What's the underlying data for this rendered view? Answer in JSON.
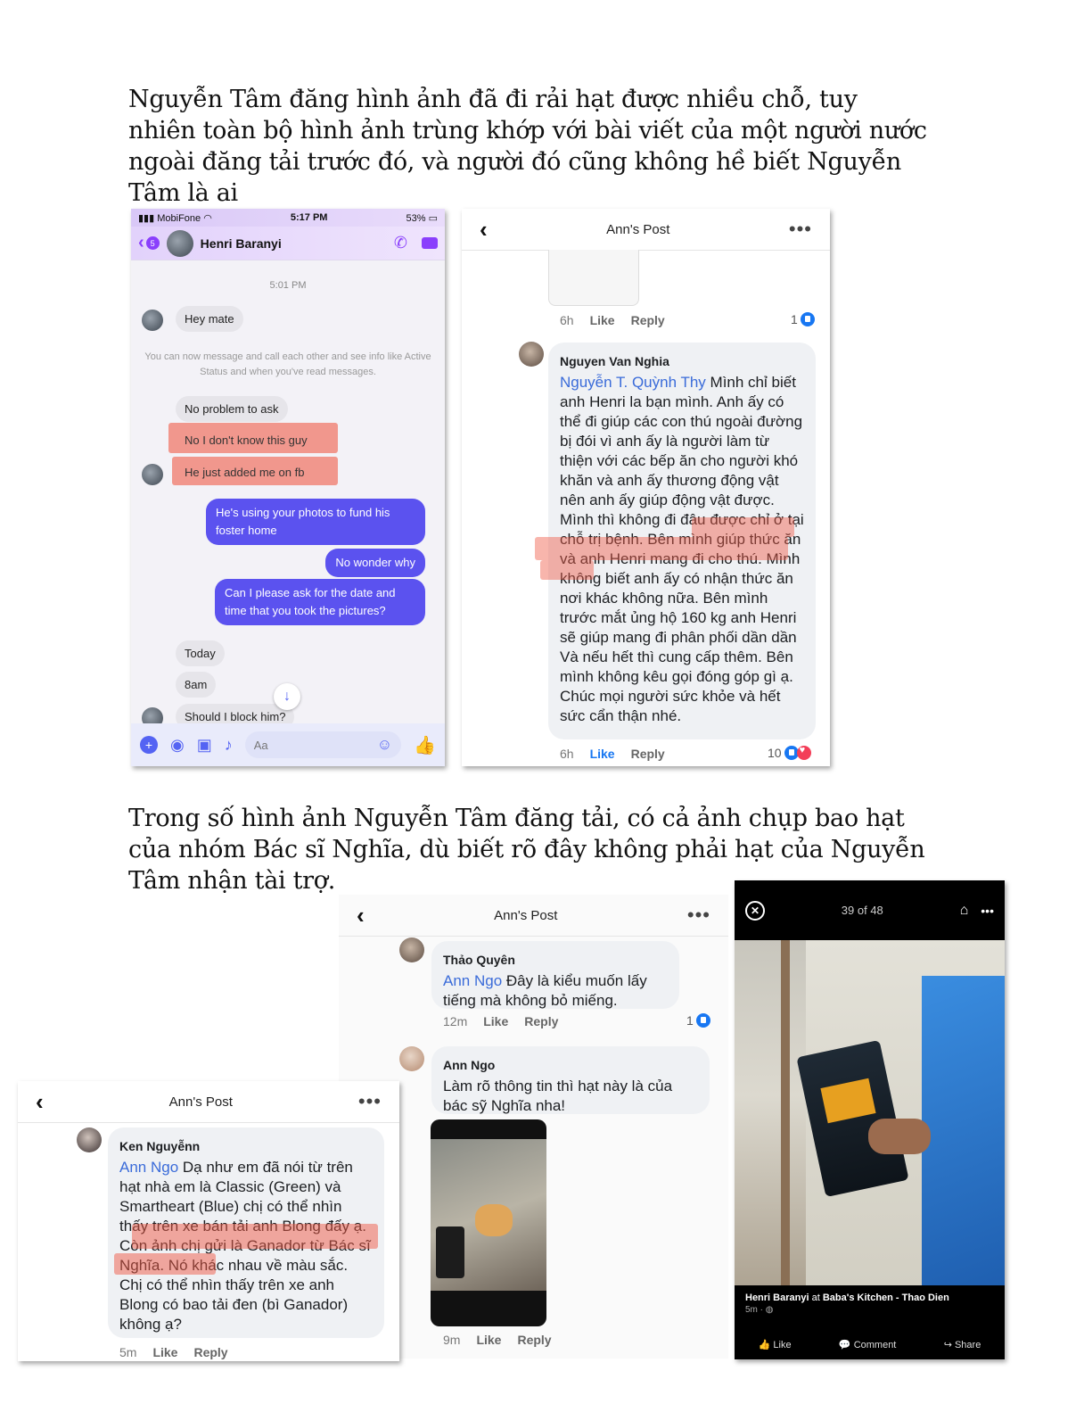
{
  "heading1": "Nguyễn Tâm đăng hình ảnh đã đi rải hạt được nhiều chỗ, tuy nhiên toàn bộ hình ảnh trùng khớp với bài viết của một người nước ngoài đăng tải trước đó, và người đó cũng không hề biết Nguyễn Tâm là ai",
  "heading2": "Trong số hình ảnh Nguyễn Tâm đăng tải, có cả ảnh chụp bao hạt của nhóm Bác sĩ Nghĩa, dù biết rõ đây không phải hạt của Nguyễn Tâm nhận tài trợ.",
  "messenger": {
    "carrier": "MobiFone",
    "time": "5:17 PM",
    "battery": "53%",
    "back_count": "5",
    "contact": "Henri Baranyi",
    "timestamp": "5:01 PM",
    "msg_hey": "Hey mate",
    "info": "You can now message and call each other and see info like Active Status and when you've read messages.",
    "msg_no_problem": "No problem to ask",
    "msg_dont_know": "No I don't know this guy",
    "msg_added": "He just added me on fb",
    "out_photos": "He's using your photos to fund his foster home",
    "out_wonder": "No wonder why",
    "out_date": "Can I please ask for the date and time that you took the pictures?",
    "msg_today": "Today",
    "msg_8am": "8am",
    "msg_block": "Should I block him?",
    "input_placeholder": "Aa",
    "accent": "#5463f3"
  },
  "post1": {
    "title": "Ann's Post",
    "meta_top": {
      "time": "6h",
      "like": "Like",
      "reply": "Reply",
      "count": "1"
    },
    "comment": {
      "author": "Nguyen Van Nghia",
      "mention": "Nguyễn T. Quỳnh Thy",
      "text": " Mình chỉ biết anh Henri la bạn mình. Anh ấy có thể đi giúp các con thú ngoài đường bị đói vì anh ấy là người làm từ thiện với các bếp ăn cho người khó khăn và anh ấy thương động vật nên anh ấy giúp động vật được. Mình thì không đi đâu được chỉ ở tại chỗ trị bệnh. Bên mình giúp thức ăn và anh Henri mang đi cho thú. Mình không biết anh ấy có nhận thức ăn nơi khác không nữa. Bên mình trước mắt ủng hộ 160 kg anh Henri sẽ giúp mang đi phân phối dần dần Và nếu hết thì cung cấp thêm. Bên mình không kêu gọi đóng góp gì ạ. Chúc mọi người sức khỏe và hết sức cẩn thận nhé."
    },
    "meta": {
      "time": "6h",
      "like": "Like",
      "reply": "Reply",
      "count": "10"
    }
  },
  "post2": {
    "title": "Ann's Post",
    "c1": {
      "author": "Thảo Quyên",
      "mention": "Ann Ngo",
      "text": " Đây là kiểu muốn lấy tiếng mà không bỏ miếng."
    },
    "c1_meta": {
      "time": "12m",
      "like": "Like",
      "reply": "Reply",
      "count": "1"
    },
    "c2": {
      "author": "Ann Ngo",
      "text": "Làm rõ thông tin thì hạt này là của bác sỹ Nghĩa nha!"
    },
    "c2_meta": {
      "time": "9m",
      "like": "Like",
      "reply": "Reply"
    }
  },
  "post3": {
    "title": "Ann's Post",
    "c": {
      "author": "Ken Nguyễnn",
      "mention": "Ann Ngo",
      "text1": " Dạ như em đã nói từ trên hạt nhà em là Classic (Green) và Smartheart (Blue) chị có thể nhìn thấy trên xe bán tải anh Blong đấy ạ. Còn ảnh chị gửi là Ganador từ Bác sĩ Nghĩa. Nó khác nhau về màu sắc. Chị có thể nhìn thấy trên xe anh Blong có bao tải đen (bì Ganador) không ạ?"
    },
    "meta": {
      "time": "5m",
      "like": "Like",
      "reply": "Reply"
    }
  },
  "viewer": {
    "counter": "39 of 48",
    "caption_name": "Henri Baranyi",
    "caption_at": "at",
    "caption_place": "Baba's Kitchen - Thao Dien",
    "caption_time": "5m",
    "like": "Like",
    "comment": "Comment",
    "share": "Share"
  }
}
